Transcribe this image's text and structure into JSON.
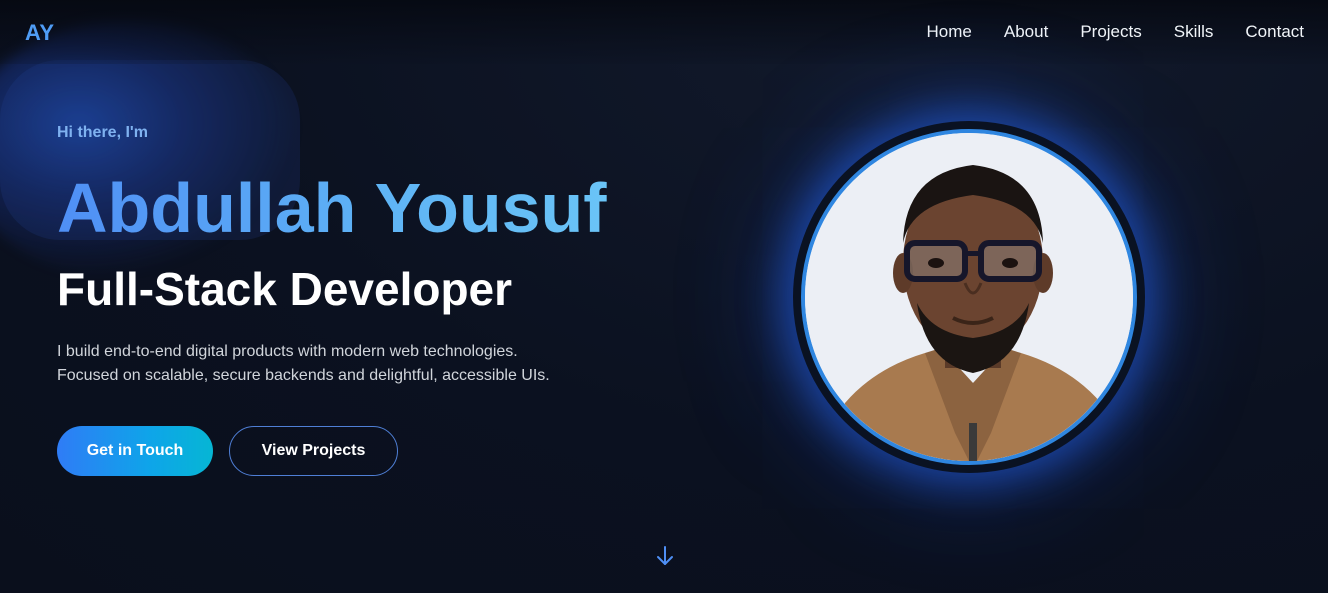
{
  "brand": {
    "logo_text": "AY"
  },
  "nav": {
    "items": [
      {
        "label": "Home"
      },
      {
        "label": "About"
      },
      {
        "label": "Projects"
      },
      {
        "label": "Skills"
      },
      {
        "label": "Contact"
      }
    ]
  },
  "hero": {
    "greeting": "Hi there, I'm",
    "name": "Abdullah Yousuf",
    "role": "Full-Stack Developer",
    "description_line1": "I build end-to-end digital products with modern web technologies.",
    "description_line2": "Focused on scalable, secure backends and delightful, accessible UIs.",
    "primary_button": "Get in Touch",
    "secondary_button": "View Projects"
  },
  "profile": {
    "icon": "profile-photo"
  },
  "scroll": {
    "icon": "arrow-down-icon"
  },
  "colors": {
    "background": "#0b1120",
    "accent": "#4f9cf5",
    "button_gradient_start": "#2f7cf6",
    "button_gradient_end": "#06b6d4",
    "ring": "#2f86e0"
  }
}
